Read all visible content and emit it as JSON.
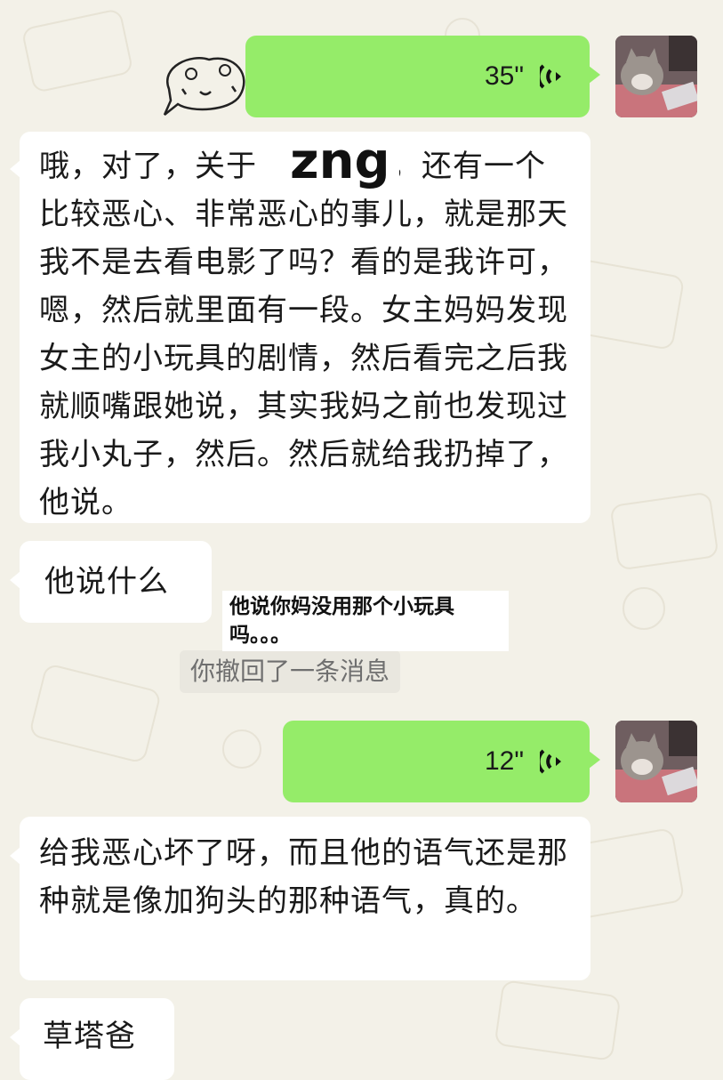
{
  "messages": {
    "voice_1": {
      "duration": "35\""
    },
    "long_text": {
      "line_1_prefix": "哦，对了，关于",
      "line_1_suffix": "，还有一个",
      "censor_word": "zng",
      "rest": "比较恶心、非常恶心的事儿，就是那天我不是去看电影了吗？看的是我许可，嗯，然后就里面有一段。女主妈妈发现女主的小玩具的剧情，然后看完之后我就顺嘴跟她说，其实我妈之前也发现过我小丸子，然后。然后就给我扔掉了，他说。"
    },
    "reply_1": "他说什么",
    "caption_overlay": "他说你妈没用那个小玩具吗。。。",
    "recall_notice": "你撤回了一条消息",
    "voice_2": {
      "duration": "12\""
    },
    "long_text_2": "给我恶心坏了呀，而且他的语气还是那种就是像加狗头的那种语气，真的。",
    "reply_2": "草塔爸"
  },
  "colors": {
    "green_bubble": "#95ec69",
    "white_bubble": "#ffffff",
    "background": "#f3f1e8"
  }
}
